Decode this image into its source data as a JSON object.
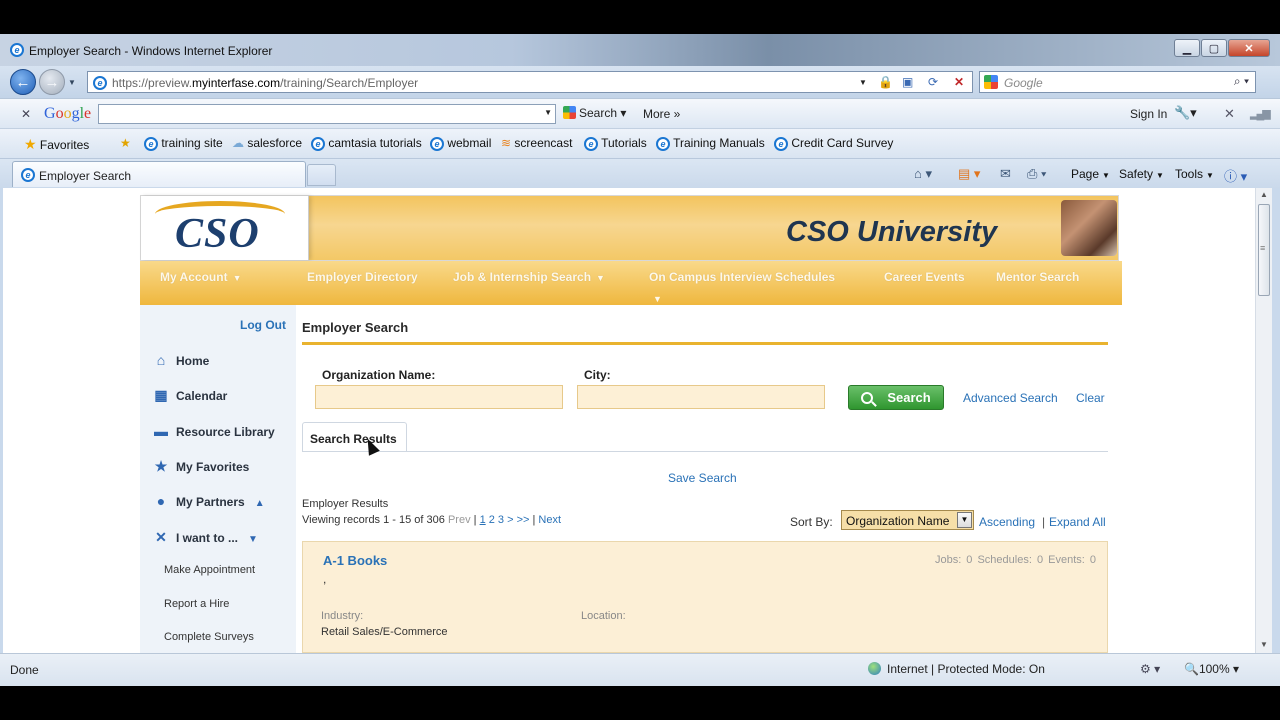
{
  "window": {
    "title": "Employer Search - Windows Internet Explorer",
    "min_icon": "minimize-icon",
    "max_icon": "maximize-icon",
    "close_icon": "close-icon"
  },
  "address": {
    "url_prefix": "https://preview.",
    "url_domain": "myinterfase.com",
    "url_path": "/training/Search/Employer",
    "search_placeholder": "Google"
  },
  "google_toolbar": {
    "logo_letters": [
      "G",
      "o",
      "o",
      "g",
      "l",
      "e"
    ],
    "search_label": "Search",
    "more_label": "More",
    "signin_label": "Sign In"
  },
  "favorites": {
    "label": "Favorites",
    "items": [
      "training site",
      "salesforce",
      "camtasia tutorials",
      "webmail",
      "screencast",
      "Tutorials",
      "Training Manuals",
      "Credit Card Survey"
    ]
  },
  "tab": {
    "title": "Employer Search"
  },
  "commands": {
    "page": "Page",
    "safety": "Safety",
    "tools": "Tools"
  },
  "cso": {
    "logo": "CSO",
    "site_title": "CSO University",
    "nav": {
      "my_account": "My Account",
      "employer_directory": "Employer Directory",
      "job_search": "Job & Internship Search",
      "interview": "On Campus Interview Schedules",
      "career_events": "Career Events",
      "mentor_search": "Mentor Search"
    },
    "sidebar": {
      "logout": "Log Out",
      "home": "Home",
      "calendar": "Calendar",
      "resource_library": "Resource Library",
      "favorites": "My Favorites",
      "partners": "My Partners",
      "i_want_to": "I want to ...",
      "sub_items": [
        "Make Appointment",
        "Report a Hire",
        "Complete Surveys"
      ]
    },
    "content": {
      "title": "Employer Search",
      "org_label": "Organization Name:",
      "city_label": "City:",
      "org_value": "",
      "city_value": "",
      "search_button": "Search",
      "advanced_search": "Advanced Search",
      "clear": "Clear",
      "tab_results": "Search Results",
      "save_search": "Save Search",
      "employer_results": "Employer Results",
      "viewing_prefix": "Viewing records 1 - 15 of 306",
      "prev": "Prev",
      "sep1": "|",
      "page_current": "1",
      "pages_rest": "2 3 > >>",
      "sep2": "|",
      "next": "Next",
      "sort_by": "Sort By:",
      "sort_value": "Organization Name",
      "ascending": "Ascending",
      "sep3": "|",
      "expand_all": "Expand All",
      "result": {
        "name": "A-1 Books",
        "stats": "Jobs: 0   Schedules: 0   Events: 0",
        "comma": ",",
        "industry_label": "Industry:",
        "location_label": "Location:",
        "industry_value": "Retail Sales/E-Commerce"
      }
    }
  },
  "status": {
    "text": "Done",
    "zone": "Internet | Protected Mode: On",
    "zoom": "100%"
  }
}
